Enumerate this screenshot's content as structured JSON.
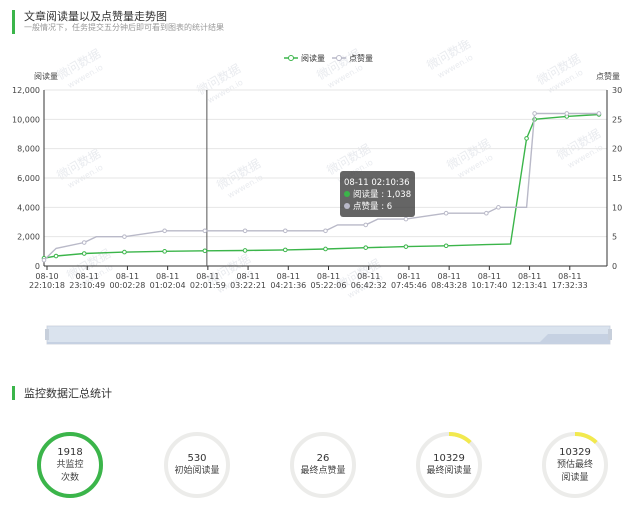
{
  "header": {
    "title": "文章阅读量以及点赞量走势图",
    "subtitle": "一般情况下，任务提交五分钟后即可看到图表的统计结果"
  },
  "summary": {
    "title": "监控数据汇总统计",
    "stats": [
      {
        "value": "1918",
        "label": "共监控次数",
        "label_lines": [
          "共监控",
          "次数"
        ],
        "ring_fill": 1.0,
        "ring_color": "#3bb54a"
      },
      {
        "value": "530",
        "label": "初始阅读量",
        "label_lines": [
          "初始阅读量"
        ],
        "ring_fill": 0.0,
        "ring_color": "#f2e94e"
      },
      {
        "value": "26",
        "label": "最终点赞量",
        "label_lines": [
          "最终点赞量"
        ],
        "ring_fill": 0.0,
        "ring_color": "#f2e94e"
      },
      {
        "value": "10329",
        "label": "最终阅读量",
        "label_lines": [
          "最终阅读量"
        ],
        "ring_fill": 0.12,
        "ring_color": "#f2e94e"
      },
      {
        "value": "10329",
        "label": "预估最终阅读量",
        "label_lines": [
          "预估最终",
          "阅读量"
        ],
        "ring_fill": 0.12,
        "ring_color": "#f2e94e"
      }
    ]
  },
  "watermark": [
    "微问数据",
    "wwwen.io"
  ],
  "chart_data": {
    "type": "line",
    "title": "",
    "legend_position": "top-center",
    "grid": true,
    "y_left": {
      "label": "阅读量",
      "ylim": [
        0,
        12000
      ],
      "ticks": [
        "0",
        "2,000",
        "4,000",
        "6,000",
        "8,000",
        "10,000",
        "12,000"
      ]
    },
    "y_right": {
      "label": "点赞量",
      "ylim": [
        0,
        30
      ],
      "ticks": [
        "0",
        "5",
        "10",
        "15",
        "20",
        "25",
        "30"
      ]
    },
    "x_ticks": [
      [
        "08-10",
        "22:10:18"
      ],
      [
        "08-11",
        "23:10:49"
      ],
      [
        "08-11",
        "00:02:28"
      ],
      [
        "08-11",
        "01:02:04"
      ],
      [
        "08-11",
        "02:01:59"
      ],
      [
        "08-11",
        "03:22:21"
      ],
      [
        "08-11",
        "04:21:36"
      ],
      [
        "08-11",
        "05:22:06"
      ],
      [
        "08-11",
        "06:42:32"
      ],
      [
        "08-11",
        "07:45:46"
      ],
      [
        "08-11",
        "08:43:28"
      ],
      [
        "08-11",
        "10:17:40"
      ],
      [
        "08-11",
        "12:13:41"
      ],
      [
        "08-11",
        "17:32:33"
      ]
    ],
    "series": [
      {
        "name": "阅读量",
        "axis": "left",
        "color": "#3bb54a",
        "points": [
          [
            0,
            530
          ],
          [
            0.3,
            680
          ],
          [
            1,
            850
          ],
          [
            2,
            950
          ],
          [
            3,
            1000
          ],
          [
            4,
            1038
          ],
          [
            5,
            1060
          ],
          [
            6,
            1100
          ],
          [
            7,
            1160
          ],
          [
            8,
            1250
          ],
          [
            9,
            1320
          ],
          [
            10,
            1380
          ],
          [
            11,
            1460
          ],
          [
            11.6,
            1500
          ],
          [
            12,
            8700
          ],
          [
            12.2,
            10000
          ],
          [
            13,
            10200
          ],
          [
            13.8,
            10329
          ]
        ],
        "markers": [
          0,
          1,
          2,
          3,
          4,
          5,
          6,
          7,
          8,
          9,
          10,
          11,
          14,
          15,
          16,
          17
        ]
      },
      {
        "name": "点赞量",
        "axis": "right",
        "color": "#b9b9c8",
        "points": [
          [
            0,
            1
          ],
          [
            0.3,
            3
          ],
          [
            1,
            4
          ],
          [
            1.3,
            5
          ],
          [
            2,
            5
          ],
          [
            3,
            6
          ],
          [
            4,
            6
          ],
          [
            5,
            6
          ],
          [
            6,
            6
          ],
          [
            7,
            6
          ],
          [
            7.3,
            7
          ],
          [
            8,
            7
          ],
          [
            8.3,
            8
          ],
          [
            9,
            8
          ],
          [
            10,
            9
          ],
          [
            11,
            9
          ],
          [
            11.3,
            10
          ],
          [
            12,
            10
          ],
          [
            12.2,
            26
          ],
          [
            13,
            26
          ],
          [
            13.8,
            26
          ]
        ],
        "markers": [
          0,
          2,
          4,
          5,
          6,
          7,
          8,
          9,
          11,
          13,
          14,
          15,
          16,
          18,
          19,
          20
        ]
      }
    ],
    "tooltip": {
      "time": "08-11 02:10:36",
      "rows": [
        {
          "name": "阅读量",
          "value": "1,038"
        },
        {
          "name": "点赞量",
          "value": "6"
        }
      ]
    },
    "crosshair_x": 4.05,
    "slider": {
      "start": 0,
      "end": 1
    }
  }
}
